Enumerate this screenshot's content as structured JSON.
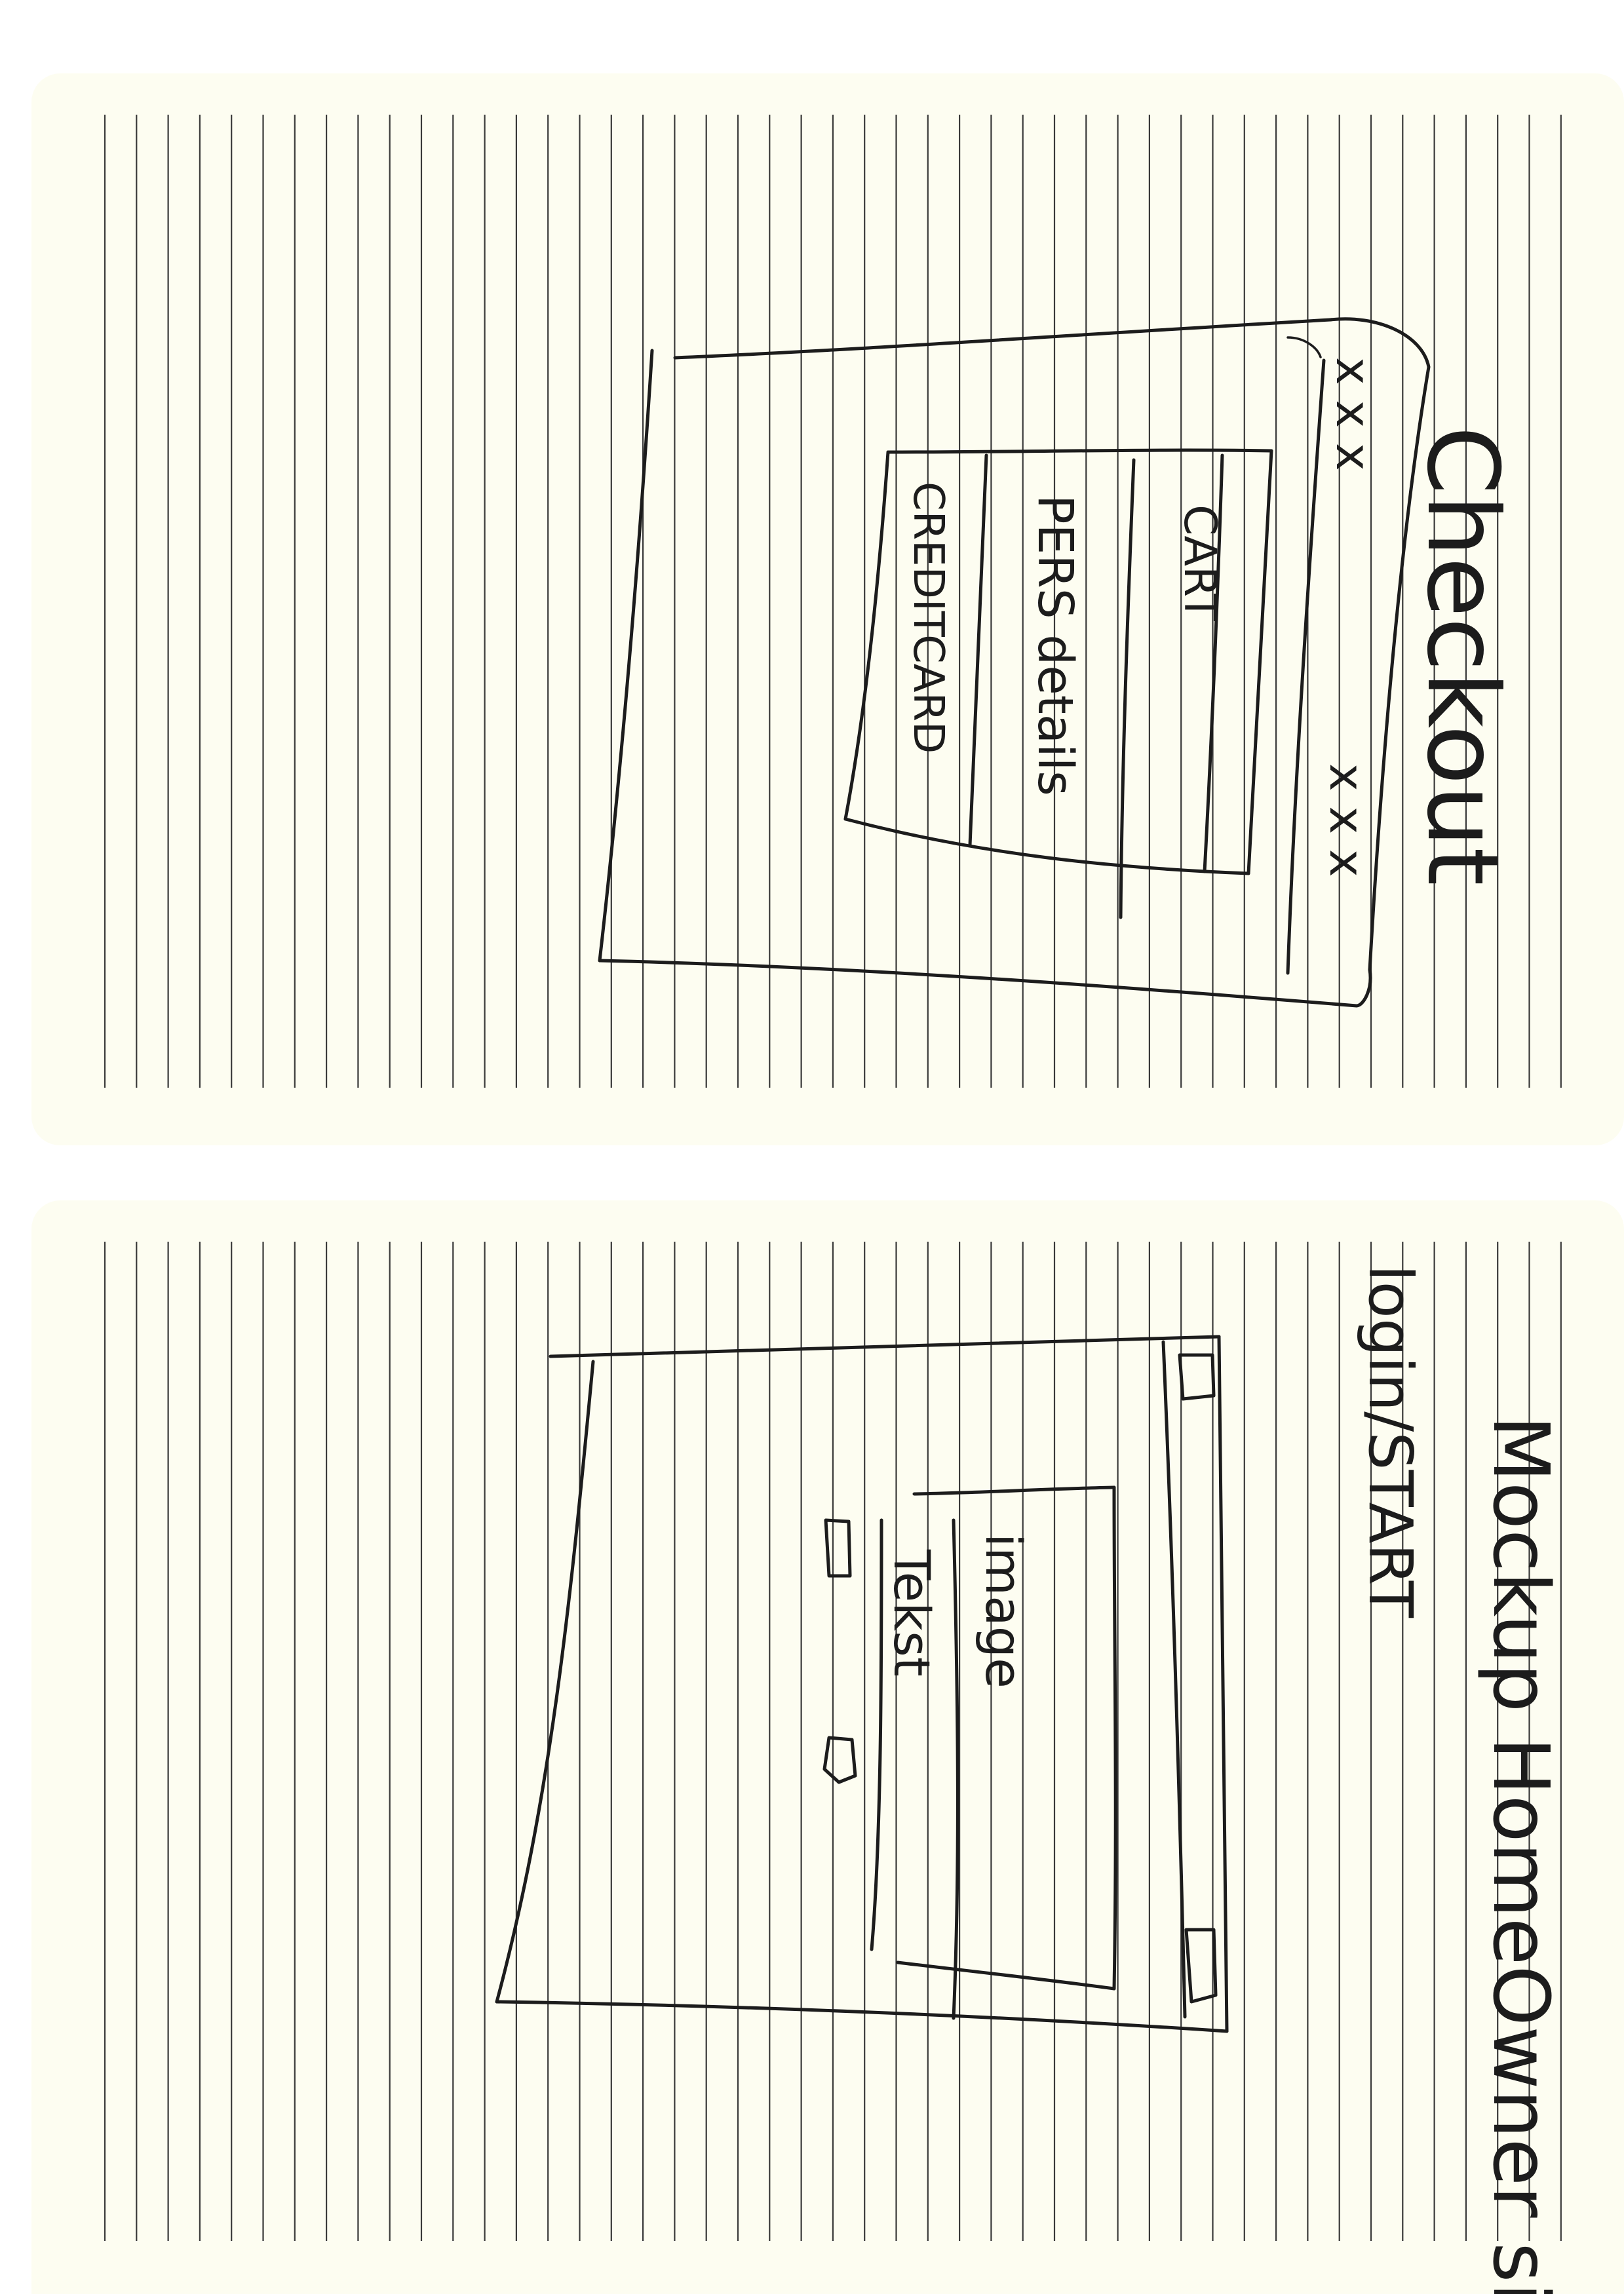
{
  "top_sheet": {
    "heading": "Checkout",
    "rows": [
      "CART",
      "PERS details",
      "CREDITCARD"
    ],
    "marks_top": "x x x",
    "marks_bottom": "x x x"
  },
  "bottom_sheet": {
    "heading": "Mockup HomeOwner site",
    "subheading": "login/START",
    "panel_lines": [
      "image",
      "Tekst"
    ]
  }
}
